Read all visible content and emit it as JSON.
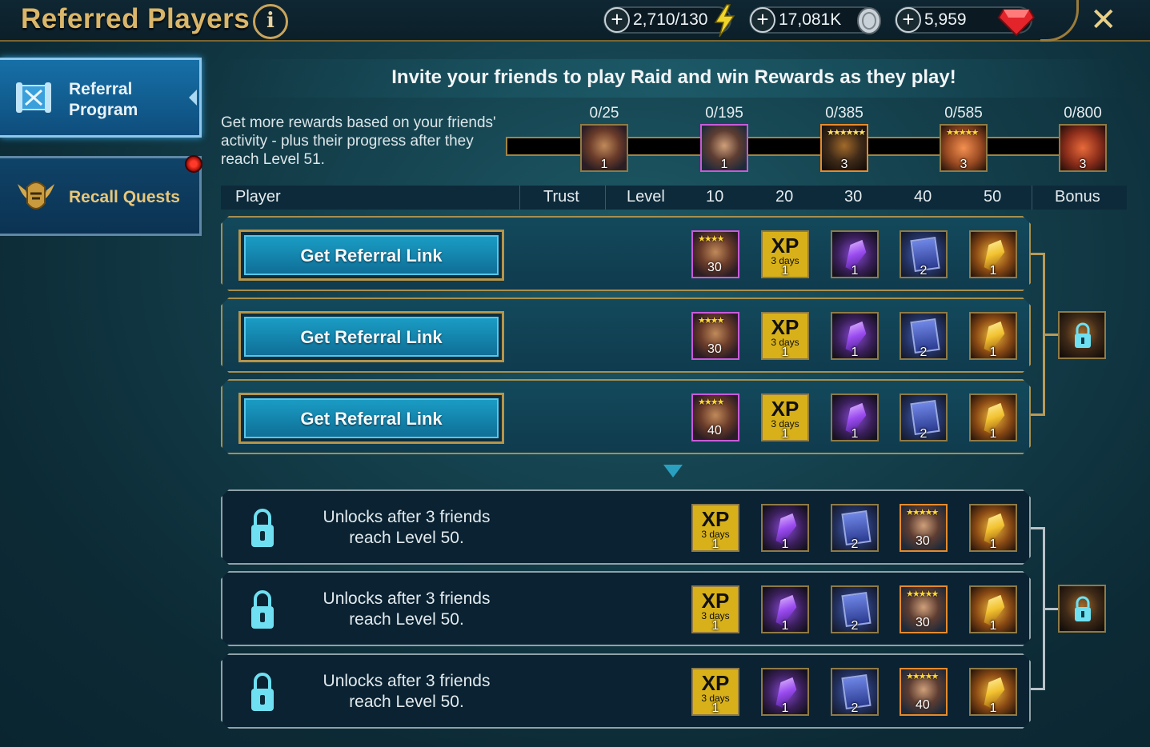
{
  "header": {
    "title": "Referred Players",
    "info_label": "i",
    "close_label": "✕"
  },
  "currencies": [
    {
      "name": "energy",
      "value": "2,710/130",
      "icon": "lightning-icon"
    },
    {
      "name": "silver",
      "value": "17,081K",
      "icon": "silver-coin-icon"
    },
    {
      "name": "gems",
      "value": "5,959",
      "icon": "ruby-gem-icon"
    }
  ],
  "sidebar": {
    "items": [
      {
        "label_line1": "Referral",
        "label_line2": "Program",
        "active": true,
        "icon": "scroll-icon"
      },
      {
        "label": "Recall Quests",
        "active": false,
        "icon": "helmet-wings-icon",
        "notification": true
      }
    ]
  },
  "main": {
    "headline": "Invite your friends to play Raid and win Rewards as they play!",
    "description": "Get more rewards based on your friends' activity - plus their progress after they reach Level 51.",
    "milestones": [
      {
        "count": "0/25",
        "qty": "1",
        "kind": "champion"
      },
      {
        "count": "0/195",
        "qty": "1",
        "kind": "champion"
      },
      {
        "count": "0/385",
        "qty": "3",
        "kind": "red-item"
      },
      {
        "count": "0/585",
        "qty": "3",
        "kind": "orange-item"
      },
      {
        "count": "0/800",
        "qty": "3",
        "kind": "tome-red"
      }
    ],
    "table_headers": {
      "player": "Player",
      "trust": "Trust",
      "level": "Level",
      "l10": "10",
      "l20": "20",
      "l30": "30",
      "l40": "40",
      "l50": "50",
      "bonus": "Bonus"
    },
    "referral_rows": [
      {
        "button": "Get Referral Link",
        "rewards": [
          {
            "kind": "champion",
            "stars": "★★★★",
            "level": "30"
          },
          {
            "kind": "xp",
            "text": "XP",
            "days": "3 days",
            "qty": "1"
          },
          {
            "kind": "shard",
            "qty": "1"
          },
          {
            "kind": "tome",
            "qty": "2"
          },
          {
            "kind": "gold-shard",
            "qty": "1"
          }
        ]
      },
      {
        "button": "Get Referral Link",
        "rewards": [
          {
            "kind": "champion",
            "stars": "★★★★",
            "level": "30"
          },
          {
            "kind": "xp",
            "text": "XP",
            "days": "3 days",
            "qty": "1"
          },
          {
            "kind": "shard",
            "qty": "1"
          },
          {
            "kind": "tome",
            "qty": "2"
          },
          {
            "kind": "gold-shard",
            "qty": "1"
          }
        ]
      },
      {
        "button": "Get Referral Link",
        "rewards": [
          {
            "kind": "champion",
            "stars": "★★★★",
            "level": "40"
          },
          {
            "kind": "xp",
            "text": "XP",
            "days": "3 days",
            "qty": "1"
          },
          {
            "kind": "shard",
            "qty": "1"
          },
          {
            "kind": "tome",
            "qty": "2"
          },
          {
            "kind": "gold-shard",
            "qty": "1"
          }
        ]
      }
    ],
    "locked_rows": [
      {
        "text_line1": "Unlocks after 3 friends",
        "text_line2": "reach Level 50.",
        "rewards": [
          {
            "kind": "xp",
            "text": "XP",
            "days": "3 days",
            "qty": "1"
          },
          {
            "kind": "shard",
            "qty": "1"
          },
          {
            "kind": "tome",
            "qty": "2"
          },
          {
            "kind": "champion",
            "stars": "★★★★★",
            "level": "30"
          },
          {
            "kind": "gold-shard",
            "qty": "1"
          }
        ]
      },
      {
        "text_line1": "Unlocks after 3 friends",
        "text_line2": "reach Level 50.",
        "rewards": [
          {
            "kind": "xp",
            "text": "XP",
            "days": "3 days",
            "qty": "1"
          },
          {
            "kind": "shard",
            "qty": "1"
          },
          {
            "kind": "tome",
            "qty": "2"
          },
          {
            "kind": "champion",
            "stars": "★★★★★",
            "level": "30"
          },
          {
            "kind": "gold-shard",
            "qty": "1"
          }
        ]
      },
      {
        "text_line1": "Unlocks after 3 friends",
        "text_line2": "reach Level 50.",
        "rewards": [
          {
            "kind": "xp",
            "text": "XP",
            "days": "3 days",
            "qty": "1"
          },
          {
            "kind": "shard",
            "qty": "1"
          },
          {
            "kind": "tome",
            "qty": "2"
          },
          {
            "kind": "champion",
            "stars": "★★★★★",
            "level": "40"
          },
          {
            "kind": "gold-shard",
            "qty": "1"
          }
        ]
      }
    ],
    "bonus": [
      {
        "kind": "gold-shard",
        "locked": true
      },
      {
        "kind": "champion",
        "locked": true
      }
    ]
  },
  "colors": {
    "accent_gold": "#c9a45a",
    "button_blue": "#1a9cc4",
    "background": "#133e4a"
  }
}
